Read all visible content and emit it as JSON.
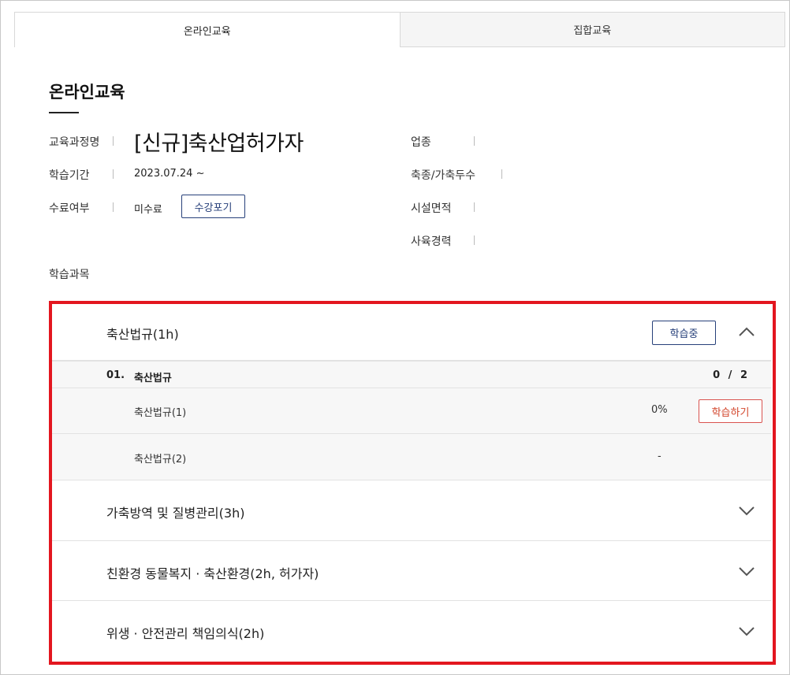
{
  "tabs": [
    {
      "label": "온라인교육"
    },
    {
      "label": "집합교육"
    }
  ],
  "section_title": "온라인교육",
  "info": {
    "course_label": "교육과정명",
    "course_name": "[신규]축산업허가자",
    "period_label": "학습기간",
    "period_value": "2023.07.24 ~",
    "completion_label": "수료여부",
    "completion_value": "미수료",
    "drop_button": "수강포기",
    "industry_label": "업종",
    "livestock_label": "축종/가축두수",
    "facility_label": "시설면적",
    "career_label": "사육경력"
  },
  "subjects_label": "학습과목",
  "accordion": [
    {
      "title": "축산법규(1h)",
      "status": "학습중",
      "expanded": true
    },
    {
      "title": "가축방역 및 질병관리(3h)",
      "expanded": false
    },
    {
      "title": "친환경 동물복지 · 축산환경(2h, 허가자)",
      "expanded": false
    },
    {
      "title": "위생 · 안전관리 책임의식(2h)",
      "expanded": false
    }
  ],
  "lesson": {
    "number": "01.",
    "name": "축산법규",
    "count": "0 / 2",
    "items": [
      {
        "name": "축산법규(1)",
        "progress": "0%",
        "action": "학습하기"
      },
      {
        "name": "축산법규(2)",
        "progress": "-"
      }
    ]
  },
  "colors": {
    "highlight": "#e3161f",
    "primary_button": "#27407a",
    "study_button": "#d3472d"
  }
}
